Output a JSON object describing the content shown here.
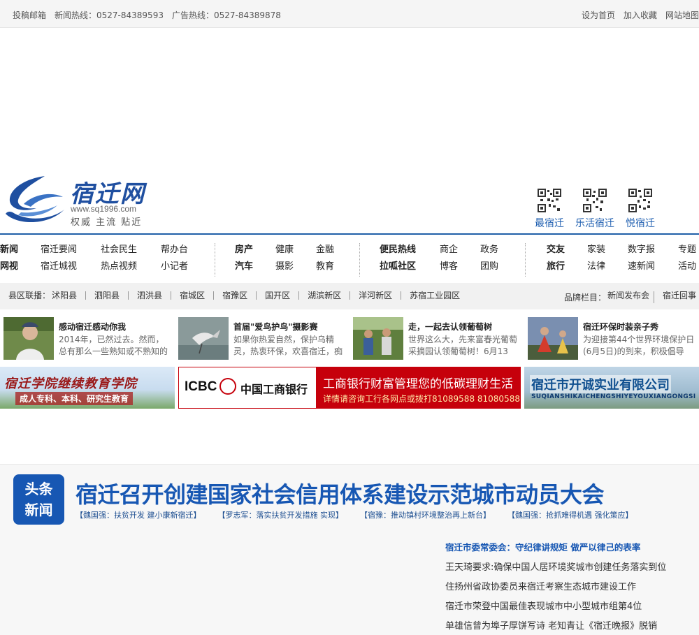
{
  "topbar": {
    "left": [
      "投稿邮箱",
      "新闻热线：0527-84389593",
      "广告热线：0527-84389878"
    ],
    "right": [
      "设为首页",
      "加入收藏",
      "网站地图"
    ]
  },
  "logo": {
    "title": "宿迁网",
    "url": "www.sq1996.com",
    "slogan": "权威  主流  贴近"
  },
  "qr": [
    "最宿迁",
    "乐活宿迁",
    "悦宿迁"
  ],
  "nav": {
    "groups": [
      [
        "新闻",
        "网视",
        "宿迁要闻",
        "宿迁城视",
        "社会民生",
        "热点视频",
        "帮办台",
        "小记者"
      ],
      [
        "房产",
        "汽车",
        "健康",
        "摄影",
        "金融",
        "教育"
      ],
      [
        "便民热线",
        "拉呱社区",
        "商企",
        "博客",
        "政务",
        "团购"
      ],
      [
        "交友",
        "旅行",
        "家装",
        "法律",
        "数字报",
        "速新闻",
        "专题",
        "活动"
      ]
    ]
  },
  "county": {
    "label": "县区联播：",
    "items": [
      "沭阳县",
      "泗阳县",
      "泗洪县",
      "宿城区",
      "宿豫区",
      "国开区",
      "湖滨新区",
      "洋河新区",
      "苏宿工业园区"
    ],
    "brand_label": "品牌栏目：",
    "brand_items": [
      "新闻发布会",
      "宿迁回事"
    ]
  },
  "cards": [
    {
      "title": "感动宿迁感动你我",
      "desc": "2014年，已然过去。然而，总有那么一些熟知或不熟知的"
    },
    {
      "title": "首届\"爱鸟护鸟\"摄影赛",
      "desc": "如果你热爱自然，保护乌精灵，热衷环保，欢喜宿迁，痴"
    },
    {
      "title": "走，一起去认领葡萄树",
      "desc": "世界这么大，先来富春光葡萄采摘园认领葡萄树！6月13"
    },
    {
      "title": "宿迁环保时装亲子秀",
      "desc": "为迎接第44个世界环境保护日(6月5日)的到来，积极倡导"
    }
  ],
  "ads": {
    "ad1_title": "宿迁学院继续教育学院",
    "ad1_sub": "成人专科、本科、研究生教育",
    "ad2_logo": "ICBC",
    "ad2_cn": "中国工商银行",
    "ad2_line1": "工商银行财富管理您的低碳理财生活",
    "ad2_line2": "详情请咨询工行各网点或拨打81089588 81080588",
    "ad3_title": "宿迁市开诚实业有限公司",
    "ad3_sub": "SUQIANSHIKAICHENGSHIYEYOUXIANGONGSI"
  },
  "headline": {
    "badge_line1": "头条",
    "badge_line2": "新闻",
    "title": "宿迁召开创建国家社会信用体系建设示范城市动员大会",
    "subs": [
      "【魏国强：扶贫开发 建小康新宿迁】",
      "【罗志军：落实扶贫开发措施 实现】",
      "【宿豫：推动镇村环境整治再上新台】",
      "【魏国强：抢抓难得机遇 强化策应】"
    ],
    "list": [
      "宿迁市委常委会：守纪律讲规矩 做严以律己的表率",
      "王天琦要求:确保中国人居环境奖城市创建任务落实到位",
      "住扬州省政协委员来宿迁考察生态城市建设工作",
      "宿迁市荣登中国最佳表现城市中小型城市组第4位",
      "单雄信曾为埠子厚饼写诗 老知青让《宿迁晚报》脱销"
    ]
  }
}
